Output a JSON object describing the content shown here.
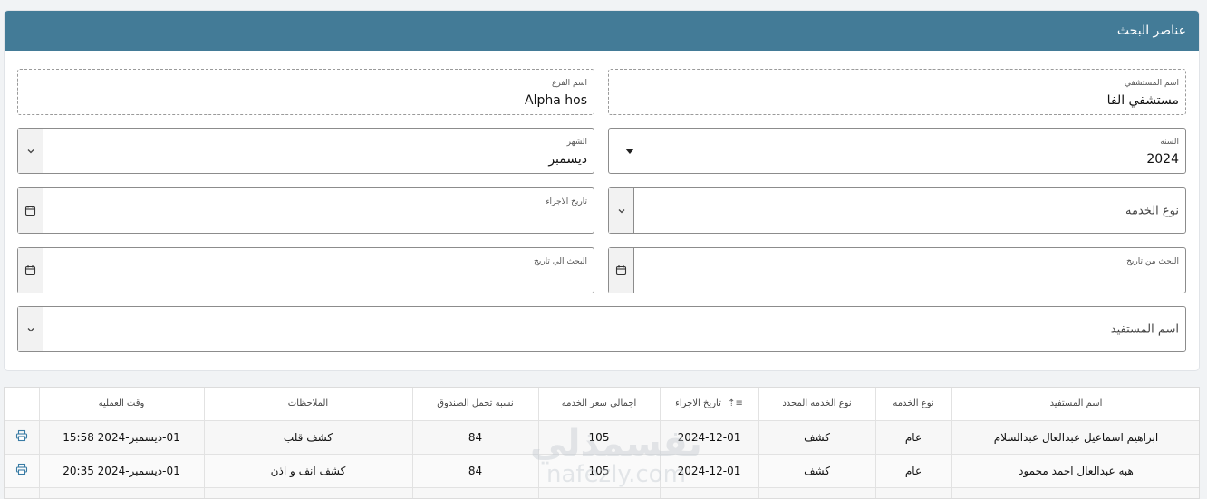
{
  "search": {
    "header_title": "عناصر البحث",
    "hospital": {
      "label": "اسم المستشفي",
      "value": "مستشفي الفا"
    },
    "branch": {
      "label": "اسم الفرع",
      "value": "Alpha hos"
    },
    "year": {
      "label": "السنه",
      "value": "2024"
    },
    "month": {
      "label": "الشهر",
      "value": "ديسمبر"
    },
    "service_type": {
      "placeholder": "نوع الخدمه"
    },
    "procedure_date": {
      "label": "تاريخ الاجراء"
    },
    "from_date": {
      "label": "البحث من تاريخ"
    },
    "to_date": {
      "label": "البحث الي تاريخ"
    },
    "beneficiary": {
      "placeholder": "اسم المستفيد"
    }
  },
  "table": {
    "headers": {
      "beneficiary": "اسم المستفيد",
      "service_type": "نوع الخدمه",
      "specific_service": "نوع الخدمه المحدد",
      "procedure_date": "تاريخ الاجراء",
      "total_price": "اجمالي سعر الخدمه",
      "fund_share": "نسبه تحمل الصندوق",
      "notes": "الملاحظات",
      "op_time": "وقت العمليه"
    },
    "rows": [
      {
        "beneficiary": "ابراهيم اسماعيل عبدالعال عبدالسلام",
        "service_type": "عام",
        "specific_service": "كشف",
        "procedure_date": "2024-12-01",
        "total_price": "105",
        "fund_share": "84",
        "notes": "كشف قلب",
        "op_time": "01-ديسمبر-2024 15:58"
      },
      {
        "beneficiary": "هبه عبدالعال احمد محمود",
        "service_type": "عام",
        "specific_service": "كشف",
        "procedure_date": "2024-12-01",
        "total_price": "105",
        "fund_share": "84",
        "notes": "كشف انف و اذن",
        "op_time": "01-ديسمبر-2024 20:35"
      }
    ]
  },
  "watermark": {
    "big": "نفسمذلي",
    "small": "nafezly.com"
  },
  "colors": {
    "header": "#437b97",
    "icon": "#3a7ca5"
  }
}
